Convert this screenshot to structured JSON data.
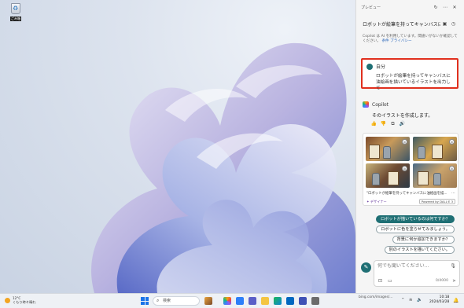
{
  "desktop": {
    "recycle_bin_label": "ごみ箱"
  },
  "copilot_pane": {
    "title": "プレビュー",
    "window_controls": [
      "refresh-icon",
      "more-icon",
      "close-icon"
    ],
    "conversation_title": "ロボットが絵筆を持ってキャンバスに絵...",
    "disclaimer": {
      "text": "Copilot は AI を利用しています。間違いがないか確認してください。",
      "links": [
        "条件",
        "プライバシー"
      ]
    },
    "user_message": {
      "author": "自分",
      "text": "ロボットが絵筆を持ってキャンバスに油絵画を描いているイラストを出力して"
    },
    "assistant": {
      "name": "Copilot",
      "reply": "そのイラストを作成します。",
      "image_caption": "\"ロボットが絵筆を持ってキャンバスに油絵画を描...",
      "designer_label": "デザイナー",
      "powered_by": "Powered by DALL·E 3"
    },
    "suggestions": [
      "ロボットが描いているのは何ですか？",
      "ロボットに色を塗らせてみましょう。",
      "背景に何か追加できますか？",
      "別のイラストを描いてください。"
    ],
    "composer": {
      "placeholder": "何でも聞いてください...",
      "counter": "0/4000"
    }
  },
  "taskbar": {
    "weather_temp": "12°C",
    "weather_desc": "くもり時々晴れ",
    "search_label": "検索",
    "tray_url": "bing.com/images/...",
    "clock_time": "10:18",
    "clock_date": "2024/03/28"
  }
}
